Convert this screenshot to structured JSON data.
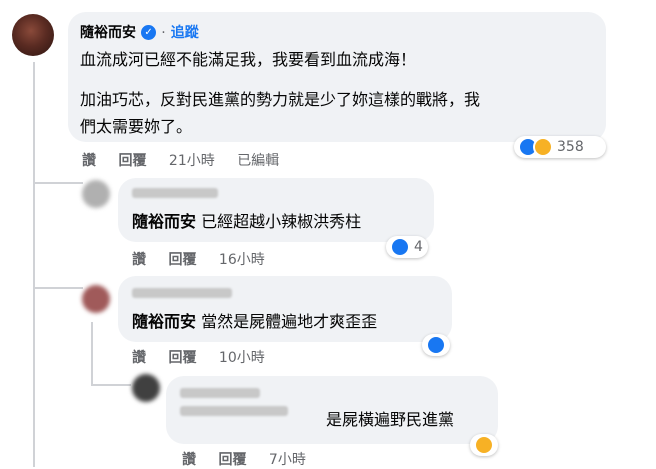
{
  "comment_main": {
    "author": "隨裕而安",
    "follow_label": "追蹤",
    "line1": "血流成河已經不能滿足我，我要看到血流成海！",
    "line2": "加油巧芯，反對民進黨的勢力就是少了妳這樣的戰將，我",
    "line3": "們太需要妳了。",
    "action_like": "讚",
    "action_reply": "回覆",
    "time": "21小時",
    "edited": "已編輯",
    "reaction_count": "358",
    "reactions": [
      "like-icon",
      "haha-icon"
    ]
  },
  "reply1": {
    "tag": "隨裕而安",
    "text": "已經超越小辣椒洪秀柱",
    "action_like": "讚",
    "action_reply": "回覆",
    "time": "16小時",
    "reaction_count": "4",
    "reactions": [
      "like-icon"
    ]
  },
  "reply2": {
    "tag": "隨裕而安",
    "text": "當然是屍體遍地才爽歪歪",
    "action_like": "讚",
    "action_reply": "回覆",
    "time": "10小時",
    "reactions": [
      "like-icon"
    ]
  },
  "reply3": {
    "text": "是屍橫遍野民進黨",
    "action_like": "讚",
    "action_reply": "回覆",
    "time": "7小時",
    "reactions": [
      "haha-icon"
    ]
  },
  "colors": {
    "accent": "#1877f2",
    "bubble": "#f0f2f5",
    "meta": "#65676b",
    "haha": "#f7b125"
  }
}
